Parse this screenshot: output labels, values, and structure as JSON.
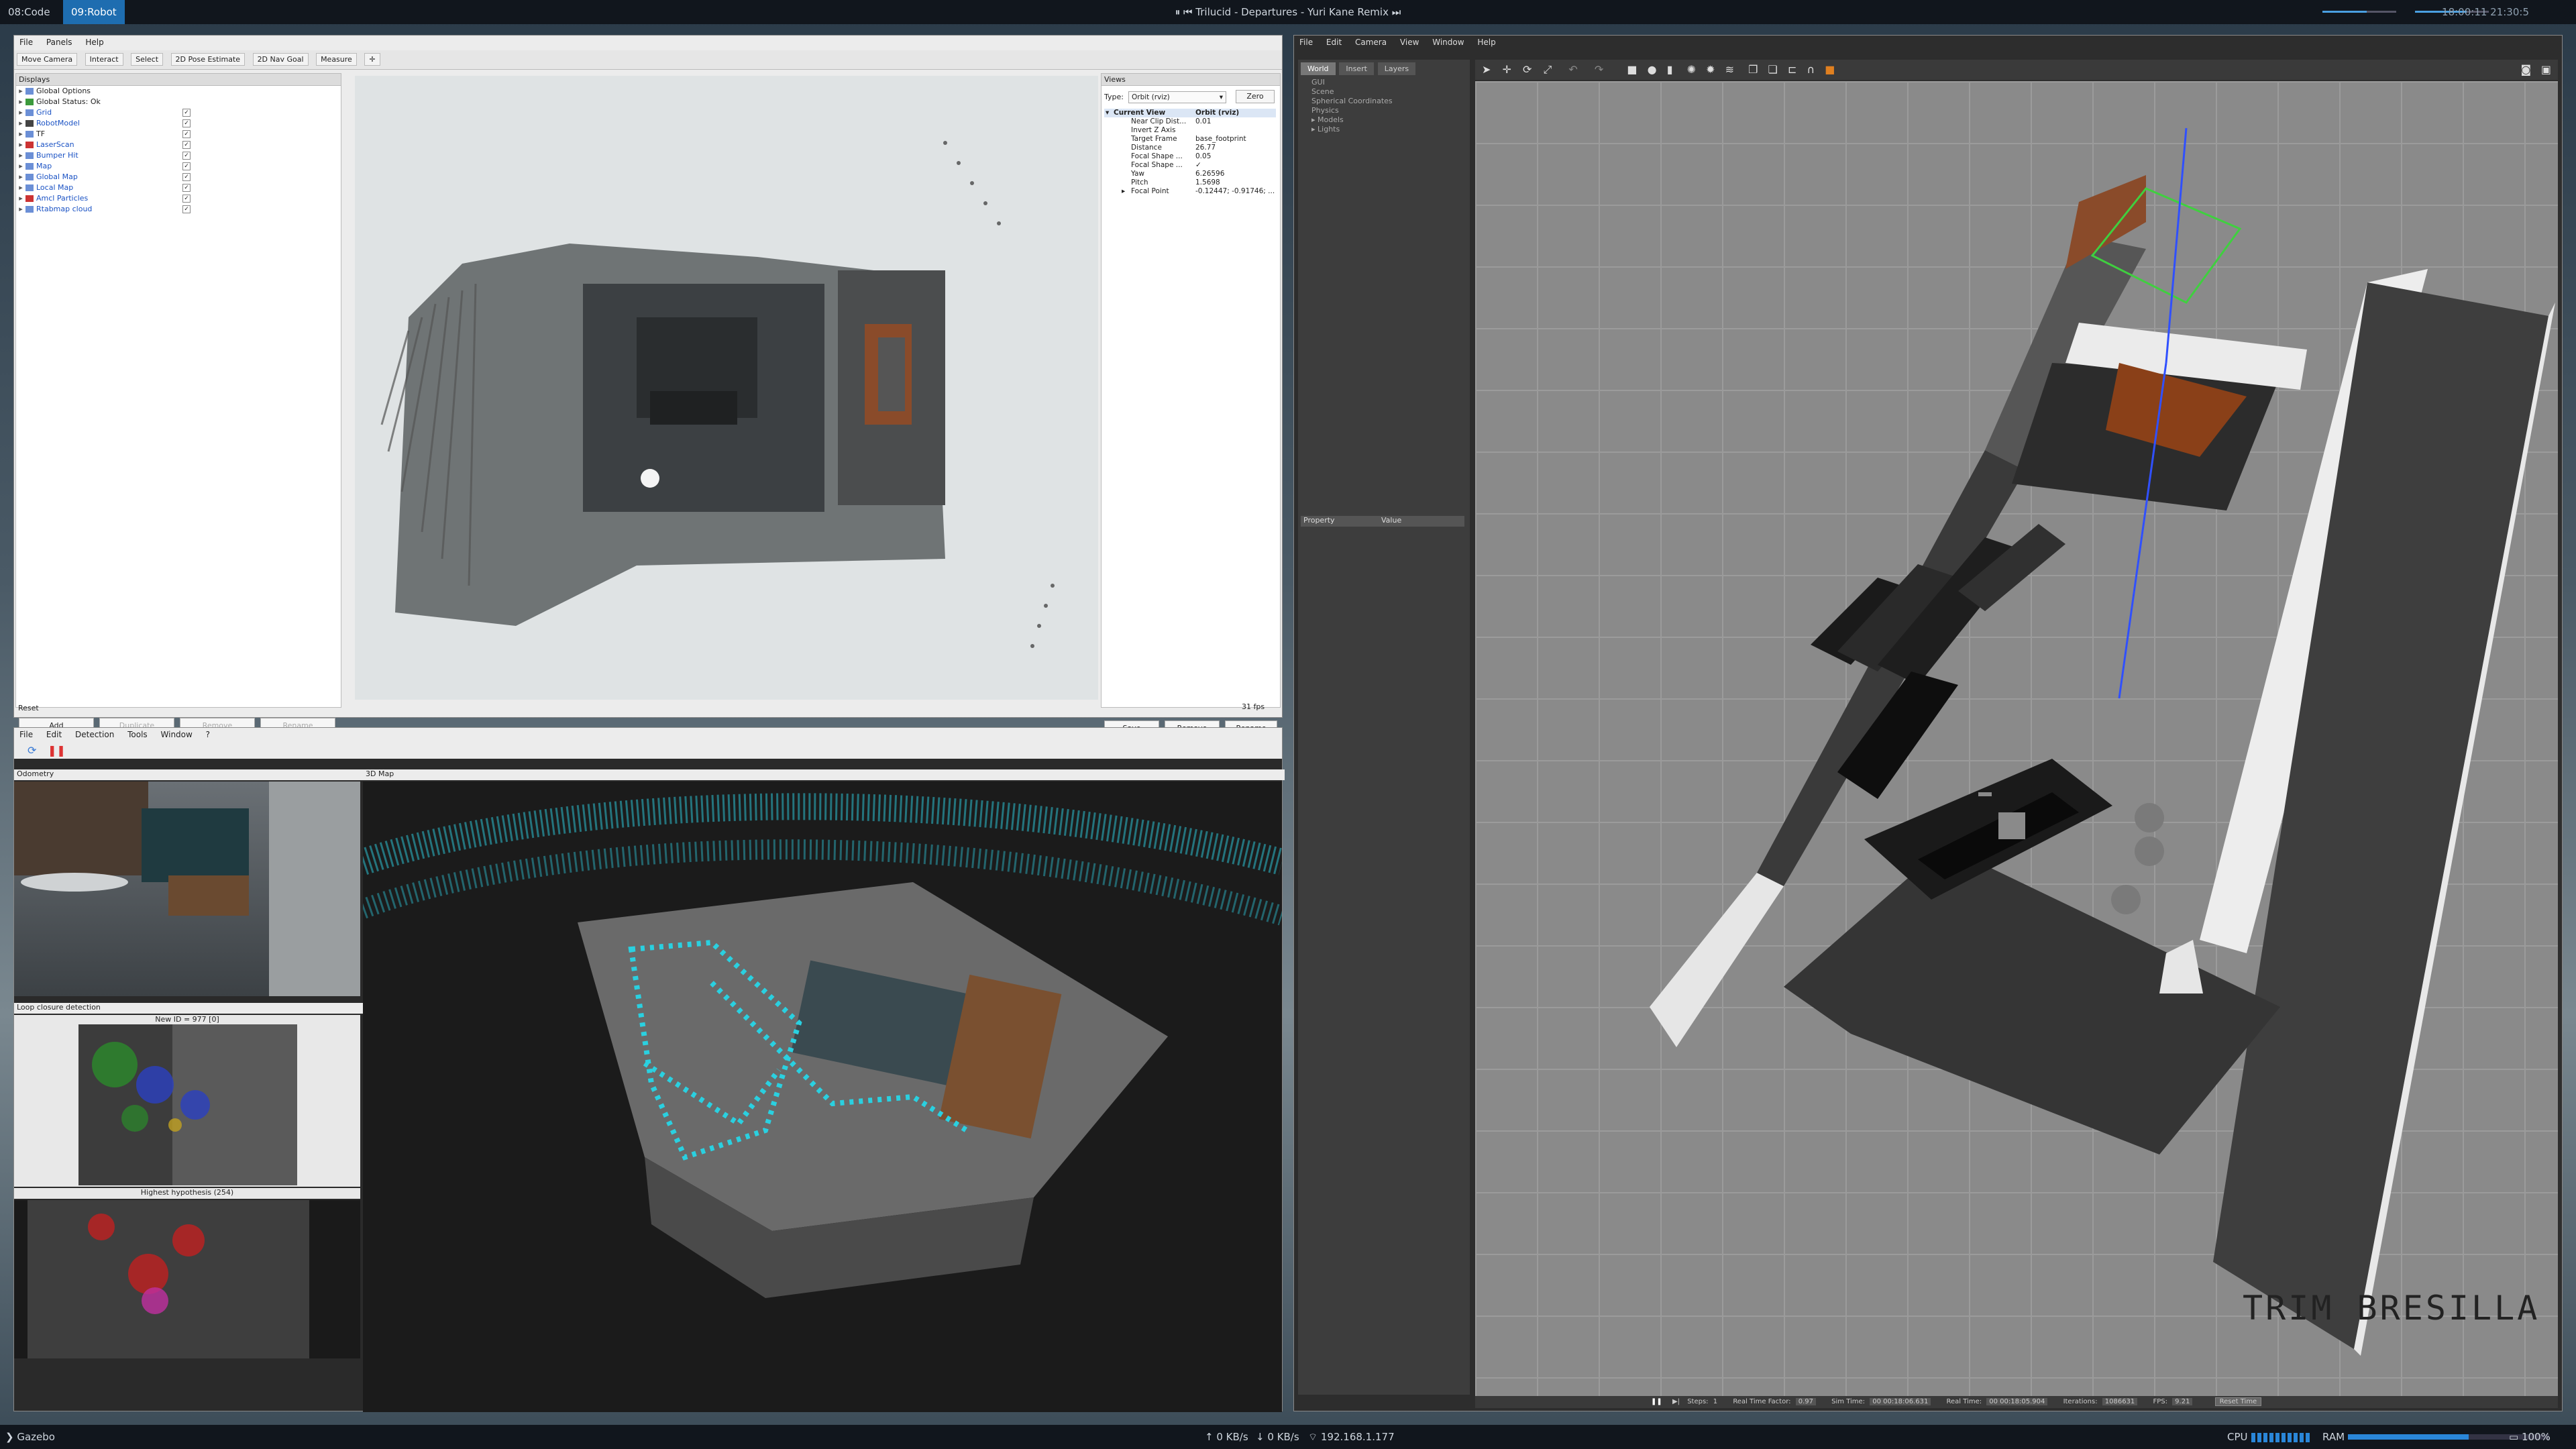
{
  "topbar": {
    "workspaces": [
      "08:Code",
      "09:Robot"
    ],
    "window_title": "Trilucid - Departures - Yuri Kane Remix",
    "clock": "18:00:11 21:30:5"
  },
  "rviz": {
    "menu": [
      "File",
      "Panels",
      "Help"
    ],
    "toolbar": [
      "Move Camera",
      "Interact",
      "Select",
      "2D Pose Estimate",
      "2D Nav Goal",
      "Measure"
    ],
    "displays_title": "Displays",
    "displays": [
      {
        "label": "Global Options",
        "checked": false,
        "blue": false,
        "icon": "#6b8fd6"
      },
      {
        "label": "Global Status: Ok",
        "checked": false,
        "blue": false,
        "icon": "#3c9a3c"
      },
      {
        "label": "Grid",
        "checked": true,
        "blue": true,
        "icon": "#6b8fd6"
      },
      {
        "label": "RobotModel",
        "checked": true,
        "blue": true,
        "icon": "#444"
      },
      {
        "label": "TF",
        "checked": true,
        "blue": false,
        "icon": "#6b8fd6"
      },
      {
        "label": "LaserScan",
        "checked": true,
        "blue": true,
        "icon": "#c33"
      },
      {
        "label": "Bumper Hit",
        "checked": true,
        "blue": true,
        "icon": "#6b8fd6"
      },
      {
        "label": "Map",
        "checked": true,
        "blue": true,
        "icon": "#6b8fd6"
      },
      {
        "label": "Global Map",
        "checked": true,
        "blue": true,
        "icon": "#6b8fd6"
      },
      {
        "label": "Local Map",
        "checked": true,
        "blue": true,
        "icon": "#6b8fd6"
      },
      {
        "label": "Amcl Particles",
        "checked": true,
        "blue": true,
        "icon": "#c33"
      },
      {
        "label": "Rtabmap cloud",
        "checked": true,
        "blue": true,
        "icon": "#6b8fd6"
      }
    ],
    "display_buttons": [
      "Add",
      "Duplicate",
      "Remove",
      "Rename"
    ],
    "reset": "Reset",
    "views_title": "Views",
    "type_label": "Type:",
    "type_value": "Orbit (rviz)",
    "zero": "Zero",
    "current_view": "Current View",
    "current_view_value": "Orbit (rviz)",
    "props": [
      {
        "k": "Near Clip Dist...",
        "v": "0.01"
      },
      {
        "k": "Invert Z Axis",
        "v": ""
      },
      {
        "k": "Target Frame",
        "v": "base_footprint"
      },
      {
        "k": "Distance",
        "v": "26.77"
      },
      {
        "k": "Focal Shape ...",
        "v": "0.05"
      },
      {
        "k": "Focal Shape ...",
        "v": "✓"
      },
      {
        "k": "Yaw",
        "v": "6.26596"
      },
      {
        "k": "Pitch",
        "v": "1.5698"
      },
      {
        "k": "Focal Point",
        "v": "-0.12447; -0.91746; ..."
      }
    ],
    "view_buttons": [
      "Save",
      "Remove",
      "Rename"
    ],
    "fps": "31 fps"
  },
  "rtab": {
    "menu": [
      "File",
      "Edit",
      "Detection",
      "Tools",
      "Window",
      "?"
    ],
    "odometry_title": "Odometry",
    "loop_title": "Loop closure detection",
    "new_id": "New ID = 977 [0]",
    "highest": "Highest hypothesis (254)",
    "map_title": "3D Map"
  },
  "gazebo": {
    "menu": [
      "File",
      "Edit",
      "Camera",
      "View",
      "Window",
      "Help"
    ],
    "tabs": [
      "World",
      "Insert",
      "Layers"
    ],
    "tree": [
      "GUI",
      "Scene",
      "Spherical Coordinates",
      "Physics",
      "Models",
      "Lights"
    ],
    "prop_headers": [
      "Property",
      "Value"
    ],
    "watermark": "TRIM BRESILLA",
    "status": {
      "steps_label": "Steps:",
      "steps_value": "1",
      "rtf_label": "Real Time Factor:",
      "rtf_value": "0.97",
      "sim_label": "Sim Time:",
      "sim_value": "00 00:18:06.631",
      "real_label": "Real Time:",
      "real_value": "00 00:18:05.904",
      "iter_label": "Iterations:",
      "iter_value": "1086631",
      "fps_label": "FPS:",
      "fps_value": "9.21",
      "reset_btn": "Reset Time"
    }
  },
  "bottombar": {
    "app": "Gazebo",
    "net_up": "0 KB/s",
    "net_down": "0 KB/s",
    "ip": "192.168.1.177",
    "cpu": "CPU",
    "ram": "RAM",
    "battery": "100%"
  }
}
